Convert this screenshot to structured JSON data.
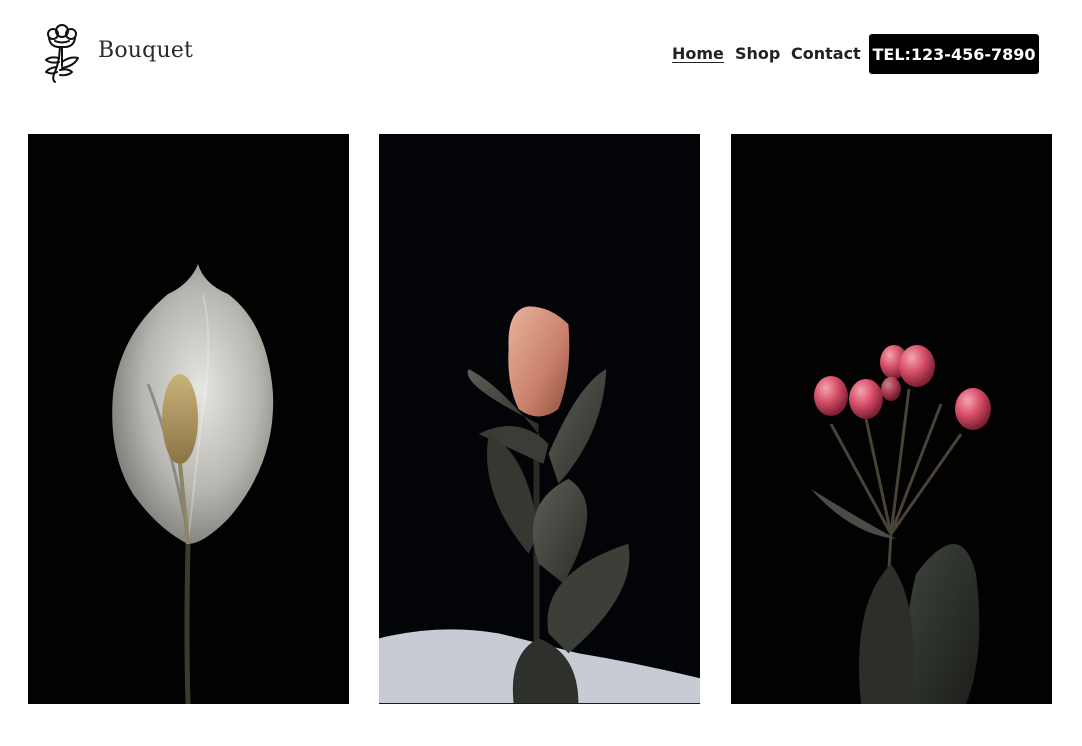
{
  "brand": {
    "name": "Bouquet",
    "logo_icon": "flower-bouquet-icon"
  },
  "nav": {
    "items": [
      "Home",
      "Shop",
      "Contact"
    ],
    "active": "Home"
  },
  "cta": {
    "label": "TEL:123-456-7890"
  },
  "gallery": {
    "images": [
      {
        "subject": "peace lily"
      },
      {
        "subject": "protea bud"
      },
      {
        "subject": "red hypericum berries"
      }
    ]
  },
  "colors": {
    "button_bg": "#000000",
    "button_text": "#ffffff",
    "photo_bg": "#030305"
  }
}
